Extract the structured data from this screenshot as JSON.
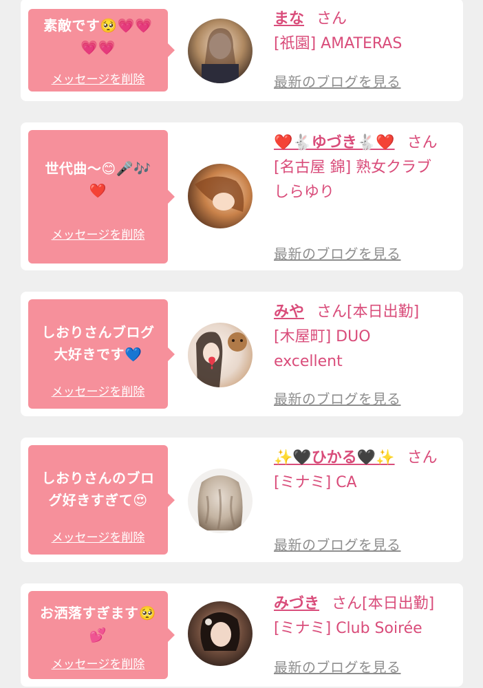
{
  "delete_label": "メッセージを削除",
  "blog_label": "最新のブログを見る",
  "san_label": "さん",
  "cards": [
    {
      "message": "素敵です🥺💗💗\n💗💗",
      "girl_name": "まな",
      "status": "",
      "shop": "[祇園] AMATERAS",
      "avatar_colors": [
        "#b08a62",
        "#3b2a20"
      ]
    },
    {
      "message": "世代曲〜😊🎤🎶\n❤️",
      "girl_name": "❤️🐇ゆづき🐇❤️",
      "status": "",
      "shop": "[名古屋 錦] 熟女クラブ\nしらゆり",
      "avatar_colors": [
        "#c9824a",
        "#4a2a1a"
      ]
    },
    {
      "message": "しおりさんブログ\n大好きです💙",
      "girl_name": "みや",
      "status": "[本日出勤]",
      "shop": "[木屋町] DUO\nexcellent",
      "avatar_colors": [
        "#e8d8cc",
        "#caa07a"
      ]
    },
    {
      "message": "しおりさんのブロ\nグ好きすぎて😍",
      "girl_name": "✨🖤ひかる🖤✨",
      "status": "",
      "shop": "[ミナミ] CA",
      "avatar_colors": [
        "#c4b4a2",
        "#7d6a58"
      ]
    },
    {
      "message": "お洒落すぎます🥺\n💕",
      "girl_name": "みづき",
      "status": "[本日出勤]",
      "shop": "[ミナミ] Club Soirée",
      "avatar_colors": [
        "#6b4a3a",
        "#1a1210"
      ]
    }
  ]
}
